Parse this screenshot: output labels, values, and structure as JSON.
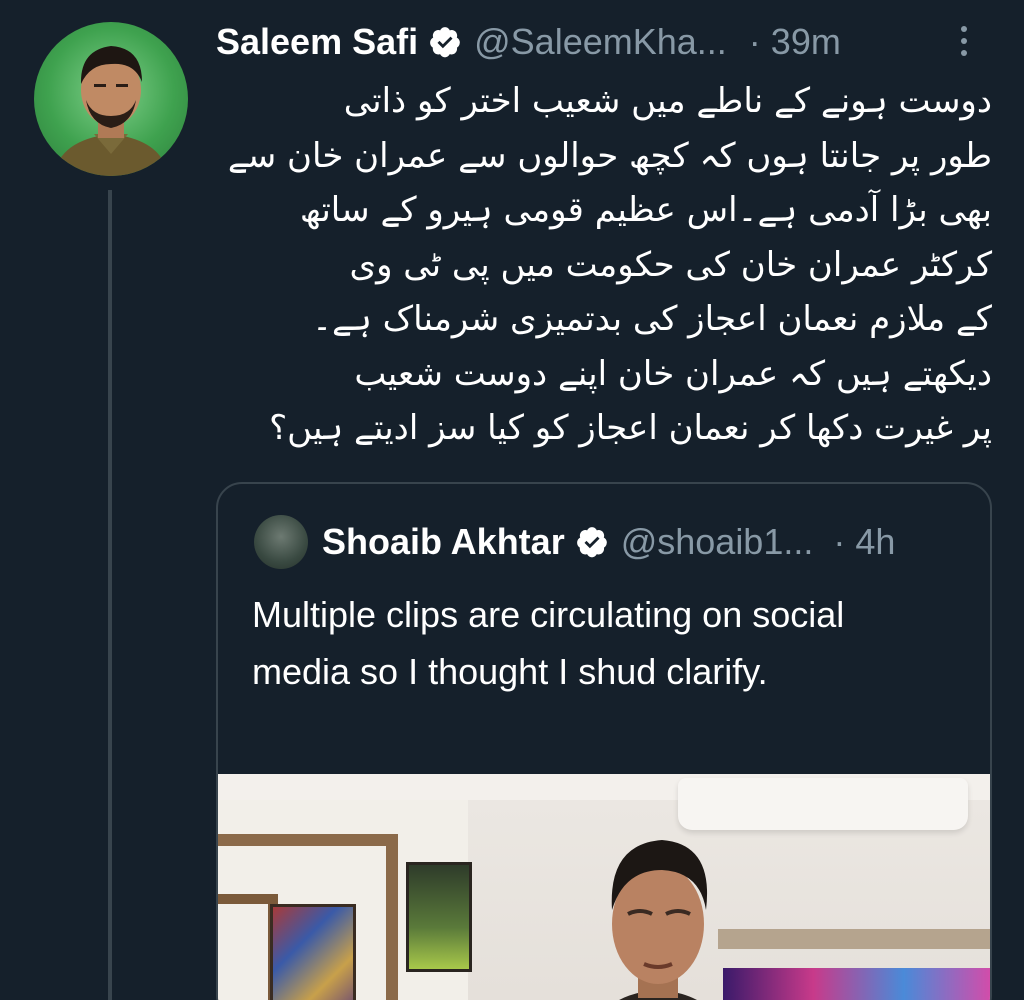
{
  "tweet": {
    "author": {
      "name": "Saleem Safi",
      "handle": "@SaleemKha...",
      "verified": true
    },
    "time_separator": "·",
    "time": "39m",
    "body_lines": [
      "دوست ہونے کے ناطے میں شعیب اختر کو ذاتی",
      "طور پر جانتا ہوں کہ کچھ حوالوں سے عمران خان سے",
      "بھی بڑا آدمی ہے۔اس عظیم قومی ہیرو کے ساتھ",
      "کرکٹر عمران خان کی حکومت میں پی ٹی وی",
      "کے ملازم نعمان اعجاز کی بدتمیزی شرمناک ہے۔",
      "دیکھتے ہیں کہ عمران خان اپنے دوست شعیب",
      "پر غیرت دکھا کر نعمان اعجاز کو کیا سز ادیتے ہیں؟"
    ],
    "more_icon": "more-vertical-icon",
    "verified_icon": "verified-badge-icon"
  },
  "quoted_tweet": {
    "author": {
      "name": "Shoaib Akhtar",
      "handle": "@shoaib1...",
      "verified": true
    },
    "time_separator": "·",
    "time": "4h",
    "text": "Multiple clips are circulating on social media so I thought I shud clarify.",
    "media_icon": "video-thumbnail"
  },
  "colors": {
    "background": "#15202b",
    "secondary_text": "#8899a6",
    "border": "#38444d",
    "verified_badge": "#ffffff"
  }
}
